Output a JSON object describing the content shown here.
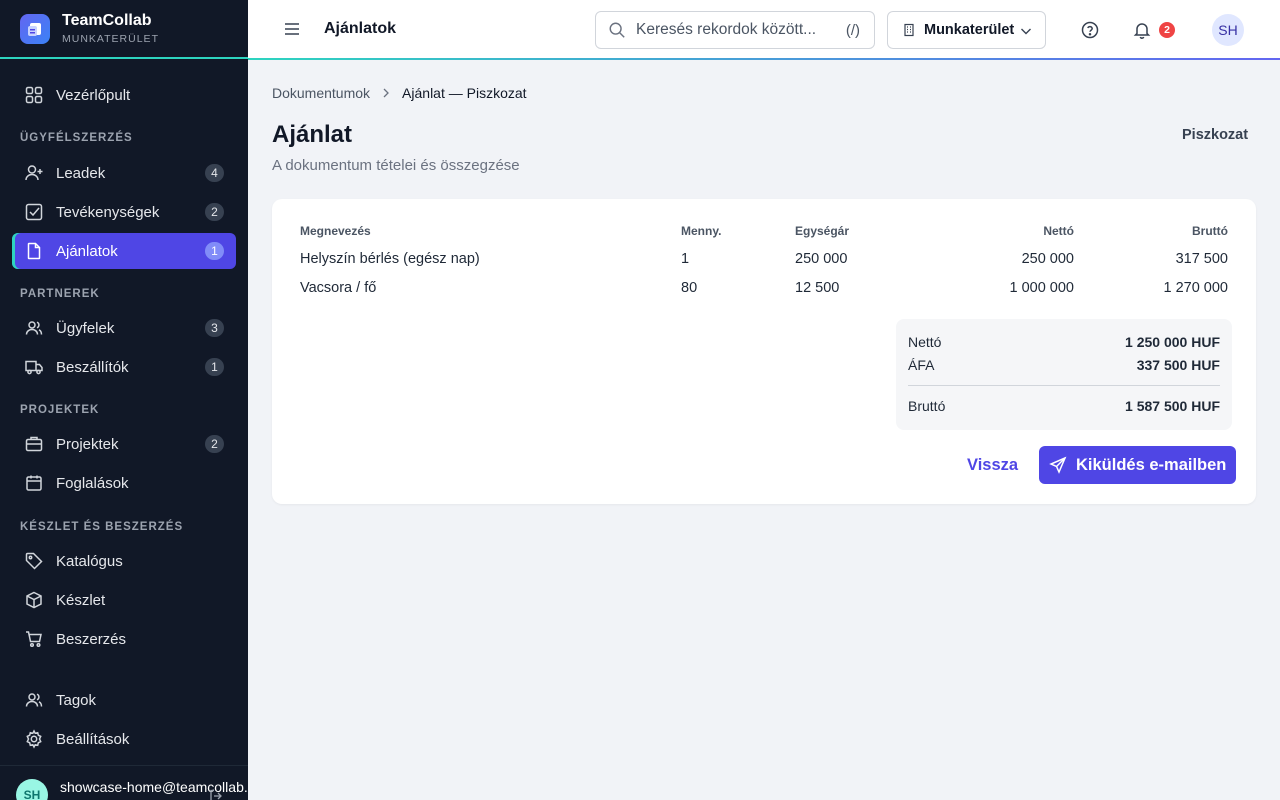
{
  "app": {
    "name": "TeamCollab",
    "subtitle": "MUNKATERÜLET"
  },
  "sidebar": {
    "dashboard": "Vezérlőpult",
    "sections": [
      "ÜGYFÉLSZERZÉS",
      "PARTNEREK",
      "PROJEKTEK",
      "KÉSZLET ÉS BESZERZÉS"
    ],
    "items": [
      {
        "label": "Leadek",
        "count": "4"
      },
      {
        "label": "Tevékenységek",
        "count": "2"
      },
      {
        "label": "Ajánlatok",
        "count": "1"
      },
      {
        "label": "Ügyfelek",
        "count": "3"
      },
      {
        "label": "Beszállítók",
        "count": "1"
      },
      {
        "label": "Projektek",
        "count": "2"
      },
      {
        "label": "Foglalások"
      },
      {
        "label": "Katalógus"
      },
      {
        "label": "Készlet"
      },
      {
        "label": "Beszerzés"
      },
      {
        "label": "Tagok"
      },
      {
        "label": "Beállítások"
      }
    ],
    "user": {
      "initials": "SH",
      "email": "showcase-home@teamcollab."
    }
  },
  "topbar": {
    "title": "Ajánlatok",
    "search_placeholder": "Keresés rekordok között...",
    "search_hint": "(/)",
    "workspace": "Munkaterület",
    "notifications": "2",
    "avatar": "SH"
  },
  "breadcrumb": {
    "parent": "Dokumentumok",
    "current": "Ajánlat — Piszkozat"
  },
  "document": {
    "title": "Ajánlat",
    "subtitle": "A dokumentum tételei és összegzése",
    "status": "Piszkozat",
    "columns": [
      "Megnevezés",
      "Menny.",
      "Egységár",
      "Nettó",
      "Bruttó"
    ],
    "rows": [
      [
        "Helyszín bérlés (egész nap)",
        "1",
        "250 000",
        "250 000",
        "317 500"
      ],
      [
        "Vacsora / fő",
        "80",
        "12 500",
        "1 000 000",
        "1 270 000"
      ]
    ],
    "totals": {
      "net_label": "Nettó",
      "net": "1 250 000 HUF",
      "vat_label": "ÁFA",
      "vat": "337 500 HUF",
      "gross_label": "Bruttó",
      "gross": "1 587 500 HUF"
    },
    "back_label": "Vissza",
    "send_label": "Kiküldés e-mailben"
  }
}
